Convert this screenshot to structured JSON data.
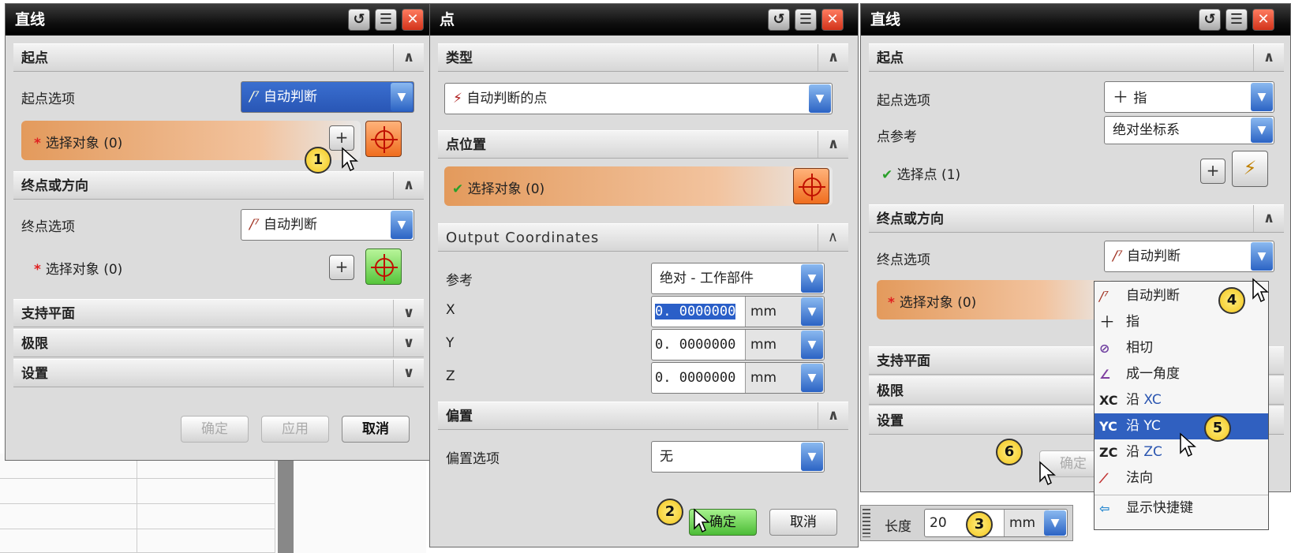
{
  "window_buttons": {
    "reset": "↺",
    "menu": "☰",
    "close": "✕"
  },
  "icons": {
    "collapse": "∧",
    "expand": "∨",
    "dropdown": "▼",
    "add": "+",
    "check": "✔",
    "ellipsis": "..."
  },
  "left_dialog": {
    "title": "直线",
    "start_section": "起点",
    "start_option_label": "起点选项",
    "start_option_value": "自动判断",
    "select_object_1": "选择对象 (0)",
    "end_section": "终点或方向",
    "end_option_label": "终点选项",
    "end_option_value": "自动判断",
    "select_object_2": "选择对象 (0)",
    "support_plane": "支持平面",
    "limits": "极限",
    "settings": "设置",
    "ok": "确定",
    "apply": "应用",
    "cancel": "取消"
  },
  "point_dialog": {
    "title": "点",
    "type_section": "类型",
    "type_value": "自动判断的点",
    "position_section": "点位置",
    "select_object": "选择对象 (0)",
    "output_section": "Output Coordinates",
    "ref_label": "参考",
    "ref_value": "绝对 - 工作部件",
    "x_label": "X",
    "y_label": "Y",
    "z_label": "Z",
    "x_value": "0. 0000000",
    "y_value": "0. 0000000",
    "z_value": "0. 0000000",
    "unit": "mm",
    "offset_section": "偏置",
    "offset_label": "偏置选项",
    "offset_value": "无",
    "ok": "确定",
    "cancel": "取消"
  },
  "right_dialog": {
    "title": "直线",
    "start_section": "起点",
    "start_option_label": "起点选项",
    "start_option_value": "指",
    "point_ref_label": "点参考",
    "point_ref_value": "绝对坐标系",
    "select_point": "选择点 (1)",
    "end_section": "终点或方向",
    "end_option_label": "终点选项",
    "end_option_value": "自动判断",
    "select_object": "选择对象 (0)",
    "support_plane": "支持平面",
    "limits": "极限",
    "settings": "设置",
    "ok": "确定"
  },
  "dropdown_menu": {
    "items": [
      {
        "icon": "",
        "label": "自动判断",
        "axis": ""
      },
      {
        "icon": "",
        "label": "指",
        "axis": ""
      },
      {
        "icon": "",
        "label": "相切",
        "axis": ""
      },
      {
        "icon": "",
        "label": "成一角度",
        "axis": ""
      },
      {
        "icon": "XC",
        "label": "沿",
        "axis": "XC"
      },
      {
        "icon": "YC",
        "label": "沿",
        "axis": "YC"
      },
      {
        "icon": "ZC",
        "label": "沿",
        "axis": "ZC"
      },
      {
        "icon": "",
        "label": "法向",
        "axis": ""
      },
      {
        "icon": "",
        "label": "显示快捷键",
        "axis": ""
      }
    ],
    "highlighted": "沿 YC"
  },
  "length_bar": {
    "label": "长度",
    "value": "20",
    "unit": "mm"
  },
  "callouts": [
    "1",
    "2",
    "3",
    "4",
    "5",
    "6"
  ]
}
